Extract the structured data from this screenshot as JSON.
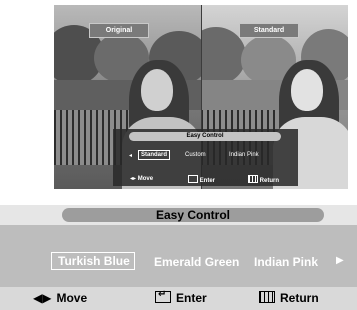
{
  "preview": {
    "left_label": "Original",
    "right_label": "Standard"
  },
  "mini_menu": {
    "title": "Easy Control",
    "options": [
      "Standard",
      "Custom",
      "Indian Pink"
    ],
    "selected_index": 0,
    "nav": {
      "move": "Move",
      "enter": "Enter",
      "return": "Return"
    }
  },
  "menu": {
    "title": "Easy Control",
    "options": [
      "Turkish Blue",
      "Emerald Green",
      "Indian Pink"
    ],
    "selected_index": 0,
    "nav": {
      "move": "Move",
      "enter": "Enter",
      "return": "Return"
    }
  },
  "icons": {
    "left_right": "left-right-arrows-icon",
    "enter": "enter-icon",
    "return": "return-icon",
    "next": "right-arrow-icon"
  },
  "colors": {
    "panel_title": "#9d9d9d",
    "options_background": "#bdbdbd",
    "nav_background": "#d9d9d9"
  }
}
